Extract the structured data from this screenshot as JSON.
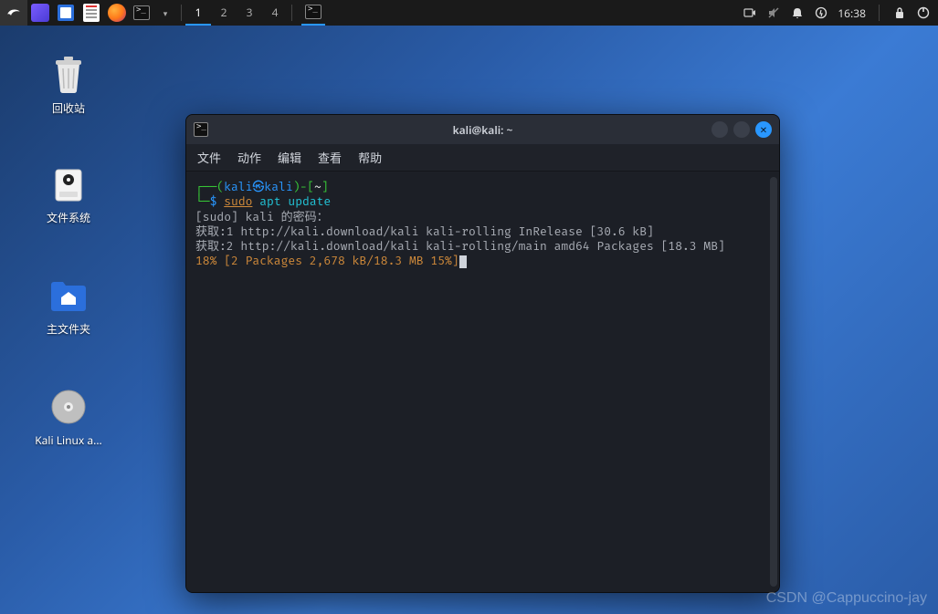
{
  "panel": {
    "workspaces": [
      "1",
      "2",
      "3",
      "4"
    ],
    "active_workspace": 0,
    "clock": "16:38"
  },
  "desktop_icons": {
    "trash": "回收站",
    "filesystem": "文件系统",
    "home": "主文件夹",
    "media": "Kali Linux a..."
  },
  "terminal": {
    "title": "kali@kali: ~",
    "menus": {
      "file": "文件",
      "actions": "动作",
      "edit": "编辑",
      "view": "查看",
      "help": "帮助"
    },
    "prompt": {
      "open": "┌──(",
      "user": "kali",
      "at": "㉿",
      "host": "kali",
      "close1": ")-[",
      "cwd": "~",
      "close2": "]",
      "line2_prefix": "└─",
      "dollar": "$ ",
      "cmd_sudo": "sudo",
      "cmd_rest": " apt update"
    },
    "lines": {
      "pw": "[sudo] kali 的密码：",
      "g1": "获取:1 http://kali.download/kali kali-rolling InRelease [30.6 kB]",
      "g2": "获取:2 http://kali.download/kali kali-rolling/main amd64 Packages [18.3 MB]",
      "progress": "18% [2 Packages 2,678 kB/18.3 MB 15%]"
    }
  },
  "watermark": "CSDN @Cappuccino-jay"
}
